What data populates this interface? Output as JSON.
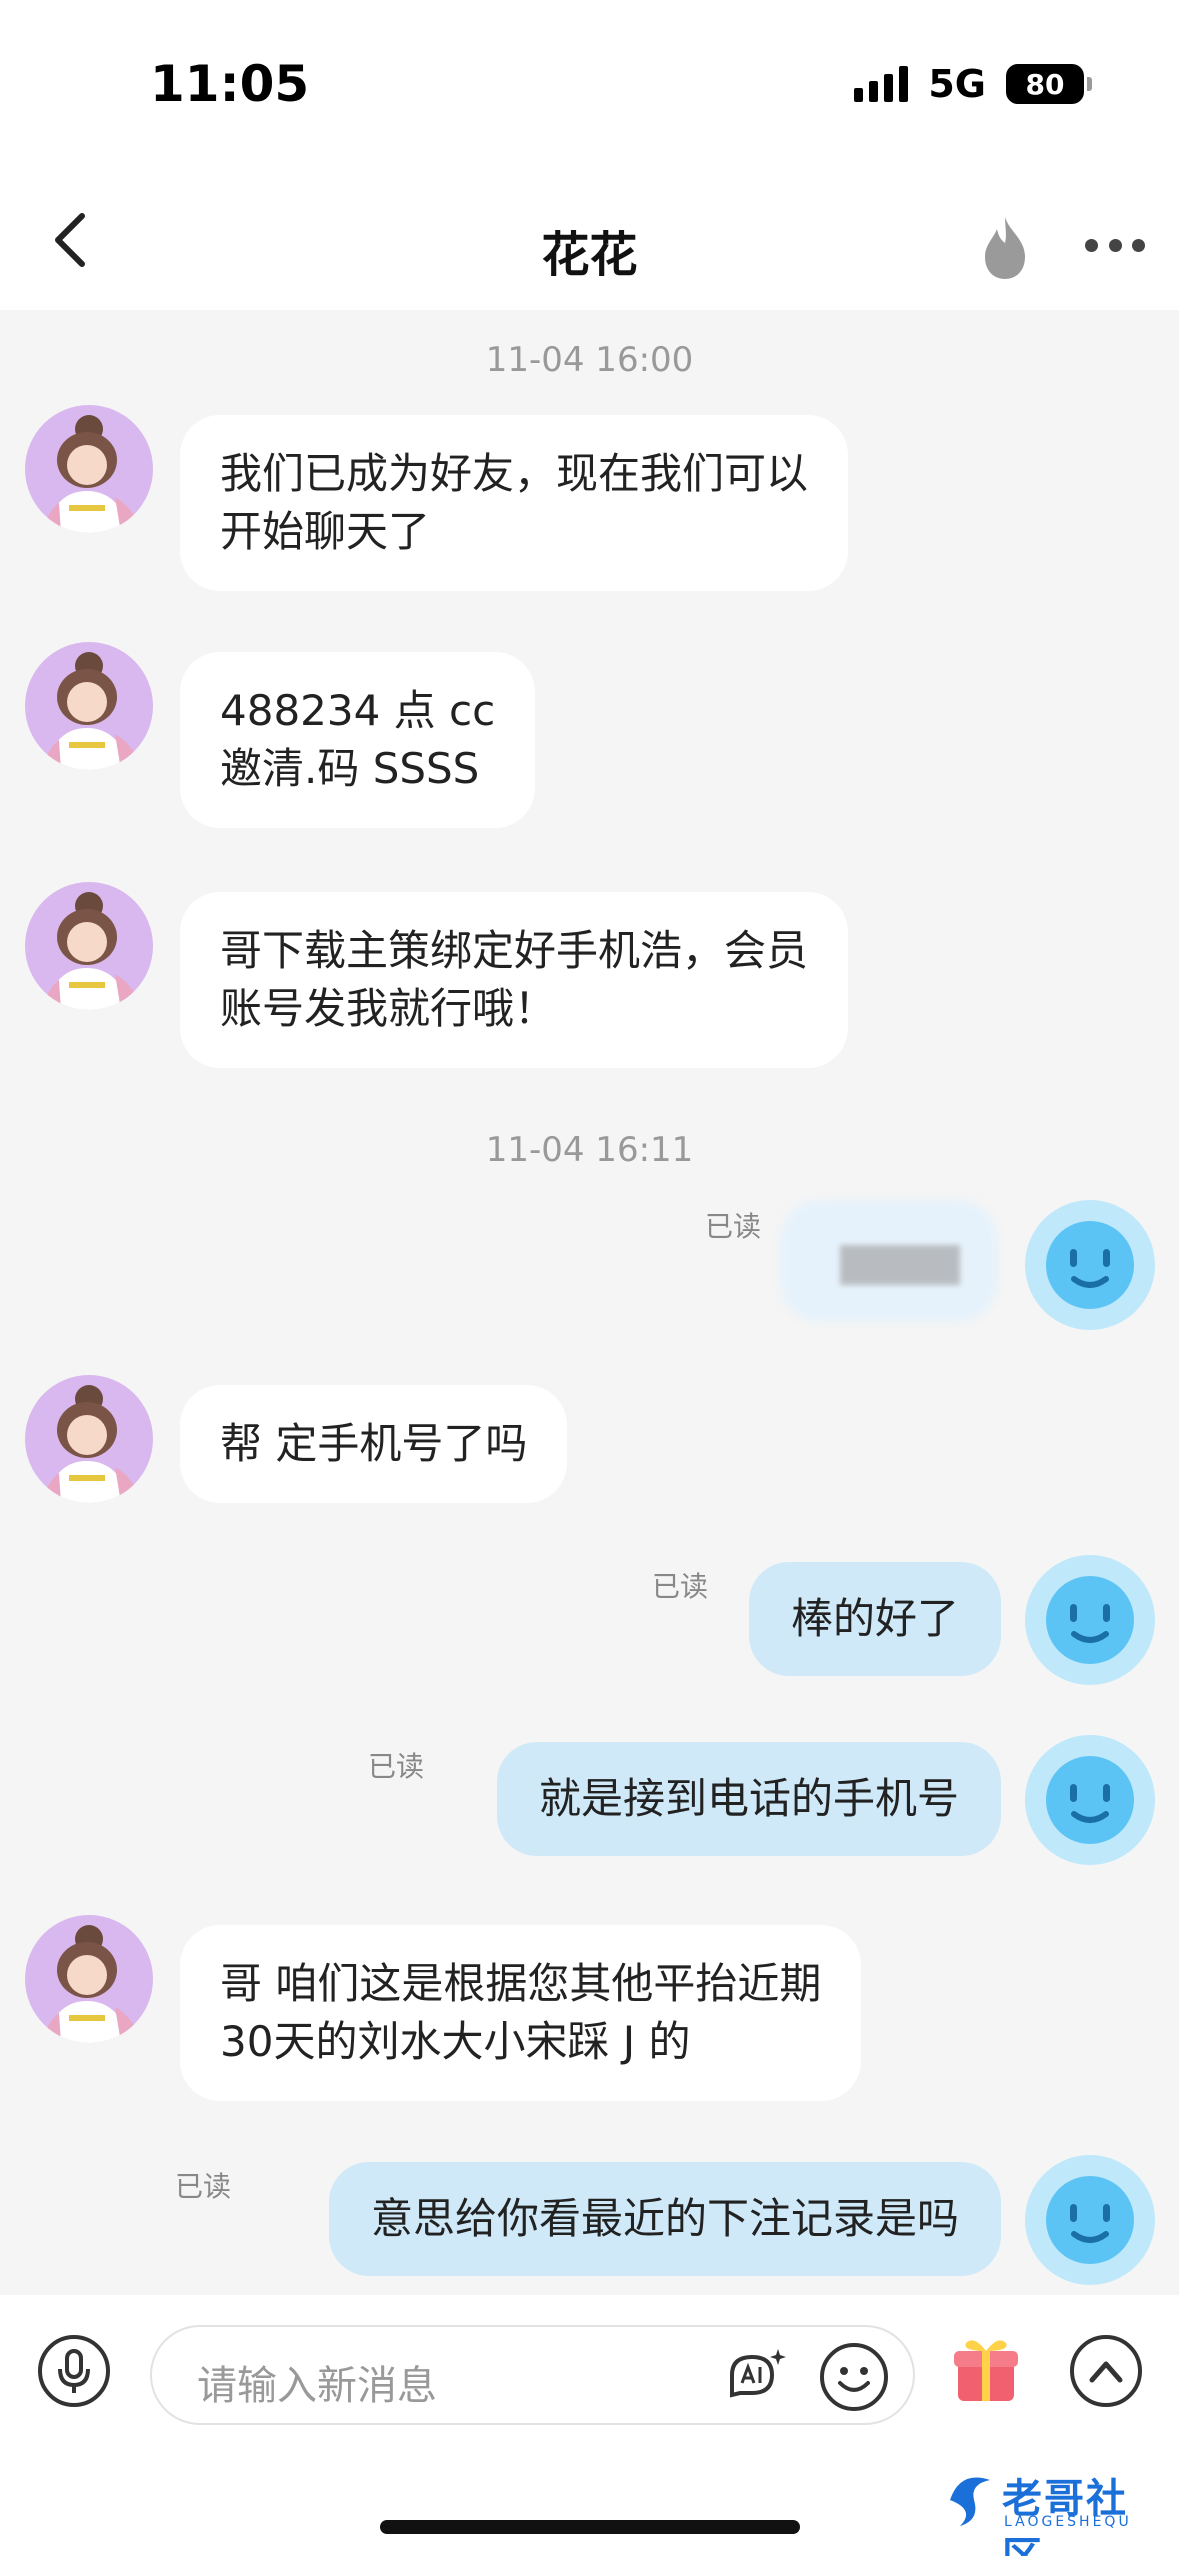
{
  "status_bar": {
    "time": "11:05",
    "network": "5G",
    "battery": "80"
  },
  "header": {
    "title": "花花"
  },
  "icons": {
    "back": "chevron-left-icon",
    "flame": "flame-icon",
    "more": "more-horizontal-icon",
    "mic": "microphone-icon",
    "ai": "ai-sparkle-icon",
    "emoji": "emoji-icon",
    "gift": "gift-icon",
    "expand": "chevron-up-icon"
  },
  "messages": {
    "ts1": "11-04 16:00",
    "m1": "我们已成为好友，现在我们可以\n开始聊天了",
    "m2": "488234 点 cc\n邀清.码   SSSS",
    "m3": "哥下载主策绑定好手机浩，会员\n账号发我就行哦！",
    "ts2": "11-04 16:11",
    "read": "已读",
    "m5": "帮 定手机号了吗",
    "m6": "棒的好了",
    "m7": "就是接到电话的手机号",
    "m8": "哥 咱们这是根据您其他平抬近期\n30天的刘水大小宋踩 J 的",
    "m9": "意思给你看最近的下注记录是吗"
  },
  "input": {
    "placeholder": "请输入新消息"
  },
  "watermark": {
    "name": "老哥社区",
    "sub": "LAOGESHEQU"
  },
  "colors": {
    "background": "#f5f5f5",
    "incoming_bubble": "#ffffff",
    "outgoing_bubble": "#cfe9f9",
    "self_avatar": "#bfe8fb",
    "peer_avatar": "#d9b8ef"
  }
}
